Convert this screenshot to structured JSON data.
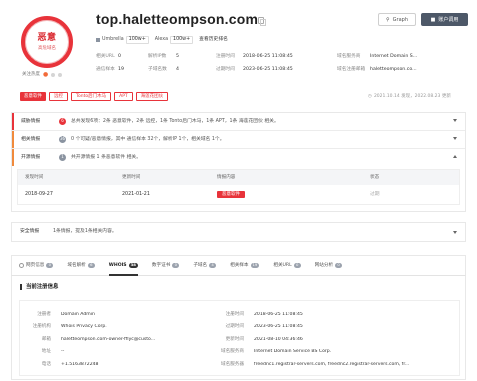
{
  "seal": {
    "big": "恶意",
    "small": "高危域名"
  },
  "follow": {
    "label": "关注热度"
  },
  "domain": "top.haletteompson.com",
  "actions": {
    "graph": "Graph",
    "account": "账户调用"
  },
  "ranks": {
    "umbrella_label": "Umbrella",
    "umbrella_value": "100w+",
    "alexa_label": "Alexa",
    "alexa_value": "100w+",
    "history_link": "查看历史排名"
  },
  "info": [
    [
      {
        "k": "相关URL",
        "v": "0"
      },
      {
        "k": "解析IP数",
        "v": "5"
      },
      {
        "k": "注册时间",
        "v": "2018-06-25 11:08:45"
      },
      {
        "k": "域名服务商",
        "v": "Internet Domain S..."
      }
    ],
    [
      {
        "k": "通信样本",
        "v": "19"
      },
      {
        "k": "子域名数",
        "v": "4"
      },
      {
        "k": "过期时间",
        "v": "2023-06-25 11:08:45"
      },
      {
        "k": "域名注册邮箱",
        "v": "haletteompson.co..."
      }
    ]
  ],
  "tags": [
    {
      "label": "恶意软件",
      "style": "solid"
    },
    {
      "label": "远控",
      "style": "outline"
    },
    {
      "label": "Tonto后门木马",
      "style": "outline"
    },
    {
      "label": "APT",
      "style": "outline"
    },
    {
      "label": "海莲花团伙",
      "style": "outline"
    }
  ],
  "updated": "2021.10.14 发现，2022.08.23 更新",
  "risk_rows": [
    {
      "title": "威胁情报",
      "count": "6",
      "desc": "总共发现6项：2条 恶意软件，2条 远控，1条 Tonto后门木马，1条 APT，1条 海莲花团伙 相关。",
      "color": "red",
      "badge": "#e8333a",
      "open": false
    },
    {
      "title": "相关情报",
      "count": "36",
      "desc": "0 个可疑/恶意情报，其中 通信样本 32个，解析IP 1个，相关域名 1个。",
      "color": "orange",
      "badge": "#8a93a0",
      "open": false
    },
    {
      "title": "开源情报",
      "count": "1",
      "desc": "共开源情报 1 条恶意软件 相关。",
      "color": "orange",
      "badge": "#8a93a0",
      "open": true
    }
  ],
  "open_table": {
    "headers": [
      "发现时间",
      "更新时间",
      "情报内容",
      "状态"
    ],
    "rows": [
      {
        "found": "2018-09-27",
        "updated": "2021-01-21",
        "tag": "恶意软件",
        "status": "过期"
      }
    ]
  },
  "safe_row": {
    "title": "安全情报",
    "desc": "1条情报，提及1条相关内容。"
  },
  "tabs": [
    {
      "label": "网页信息",
      "count": "0",
      "active": false
    },
    {
      "label": "域名解析",
      "count": "6",
      "active": false
    },
    {
      "label": "WHOIS",
      "count": "38",
      "active": true
    },
    {
      "label": "数字证书",
      "count": "0",
      "active": false
    },
    {
      "label": "子域名",
      "count": "4",
      "active": false
    },
    {
      "label": "相关样本",
      "count": "19",
      "active": false
    },
    {
      "label": "相关URL",
      "count": "0",
      "active": false
    },
    {
      "label": "网站分析",
      "count": "0",
      "active": false
    }
  ],
  "whois": {
    "title": "当前注册信息",
    "rows": [
      {
        "k1": "注册者",
        "v1": "Domain Admin",
        "k2": "注册时间",
        "v2": "2018-06-25 11:08:45"
      },
      {
        "k1": "注册机构",
        "v1": "Whois Privacy Corp.",
        "k2": "过期时间",
        "v2": "2023-06-25 11:08:45"
      },
      {
        "k1": "邮箱",
        "v1": "haletteompson.com-owner-fflyc@custo...",
        "k2": "更新时间",
        "v2": "2021-08-10 04:36:46"
      },
      {
        "k1": "地址",
        "v1": "--",
        "k2": "域名服务商",
        "v2": "Internet Domain Service BS Corp."
      },
      {
        "k1": "电话",
        "v1": "+1.5163872248",
        "k2": "域名服务器",
        "v2": "freednc1.registrar-servers.com, freednc2.registrar-servers.com, fr..."
      }
    ]
  }
}
